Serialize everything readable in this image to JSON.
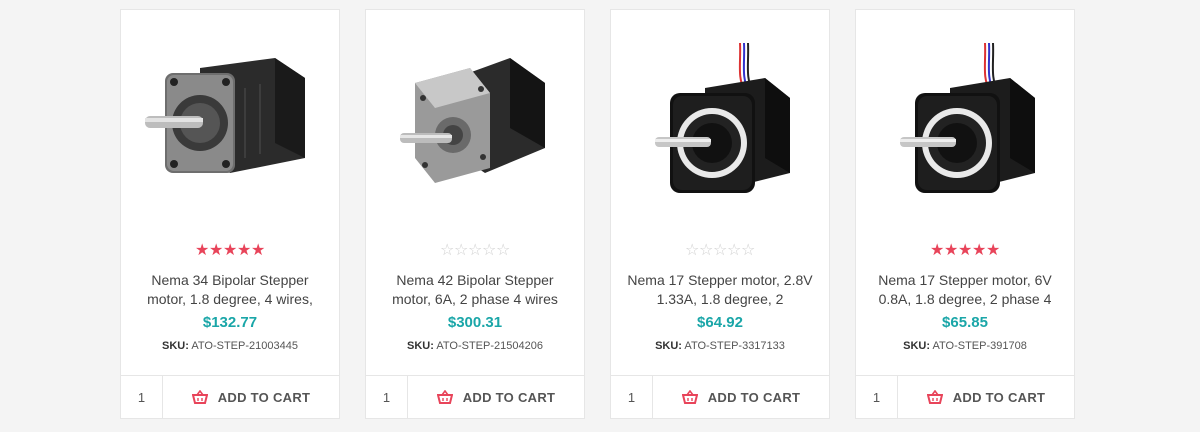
{
  "products": [
    {
      "title": "Nema 34 Bipolar Stepper motor, 1.8 degree, 4 wires,",
      "price": "$132.77",
      "sku_label": "SKU:",
      "sku": "ATO-STEP-21003445",
      "rating": 5,
      "qty": "1",
      "cart_label": "ADD TO CART",
      "image_icon": "nema34-motor-icon"
    },
    {
      "title": "Nema 42 Bipolar Stepper motor, 6A, 2 phase 4 wires",
      "price": "$300.31",
      "sku_label": "SKU:",
      "sku": "ATO-STEP-21504206",
      "rating": 0,
      "qty": "1",
      "cart_label": "ADD TO CART",
      "image_icon": "nema42-motor-icon"
    },
    {
      "title": "Nema 17 Stepper motor, 2.8V 1.33A, 1.8 degree, 2",
      "price": "$64.92",
      "sku_label": "SKU:",
      "sku": "ATO-STEP-3317133",
      "rating": 0,
      "qty": "1",
      "cart_label": "ADD TO CART",
      "image_icon": "nema17-motor-icon"
    },
    {
      "title": "Nema 17 Stepper motor, 6V 0.8A, 1.8 degree, 2 phase 4",
      "price": "$65.85",
      "sku_label": "SKU:",
      "sku": "ATO-STEP-391708",
      "rating": 5,
      "qty": "1",
      "cart_label": "ADD TO CART",
      "image_icon": "nema17-motor-icon"
    }
  ],
  "colors": {
    "star_filled": "#e8445a",
    "star_empty": "#d0d0d0",
    "price": "#1aa6a8",
    "cart_icon": "#e8445a"
  }
}
